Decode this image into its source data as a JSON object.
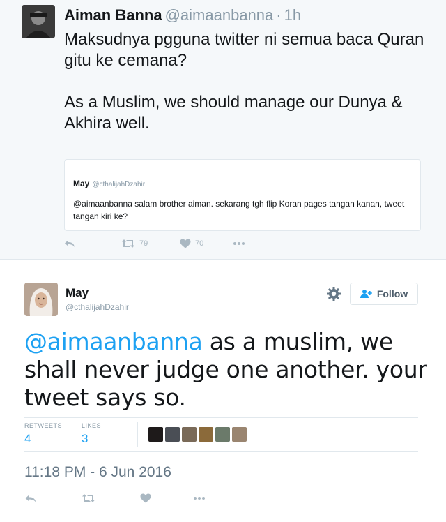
{
  "top_tweet": {
    "name": "Aiman Banna",
    "handle": "@aimaanbanna",
    "separator": "·",
    "time": "1h",
    "text_lines": [
      "Maksudnya pgguna twitter ni semua baca Quran gitu ke cemana?",
      "As a Muslim, we should manage our Dunya & Akhira well."
    ],
    "quote": {
      "name": "May",
      "handle": "@cthalijahDzahir",
      "text": "@aimaanbanna salam brother aiman. sekarang tgh flip Koran pages tangan kanan, tweet tangan kiri ke?"
    },
    "actions": {
      "reply_icon": "reply-icon",
      "retweet_icon": "retweet-icon",
      "retweets": "79",
      "like_icon": "heart-icon",
      "likes": "70",
      "more_icon": "more-icon"
    }
  },
  "main_tweet": {
    "name": "May",
    "handle": "@cthalijahDzahir",
    "follow_label": "Follow",
    "text_mention": "@aimaanbanna",
    "text_rest": " as a muslim, we shall never judge one another. your tweet says so.",
    "stats": {
      "retweets_label": "RETWEETS",
      "retweets_value": "4",
      "likes_label": "LIKES",
      "likes_value": "3"
    },
    "liker_colors": [
      "#1e1a1a",
      "#4a4e55",
      "#7a6a58",
      "#8b6a3a",
      "#6b7a6a",
      "#9a8570"
    ],
    "timestamp": "11:18 PM - 6 Jun 2016"
  },
  "colors": {
    "accent": "#1da1f2",
    "muted": "#8899a6",
    "icon": "#aab8c2",
    "card_bg": "#f5f8fa"
  }
}
